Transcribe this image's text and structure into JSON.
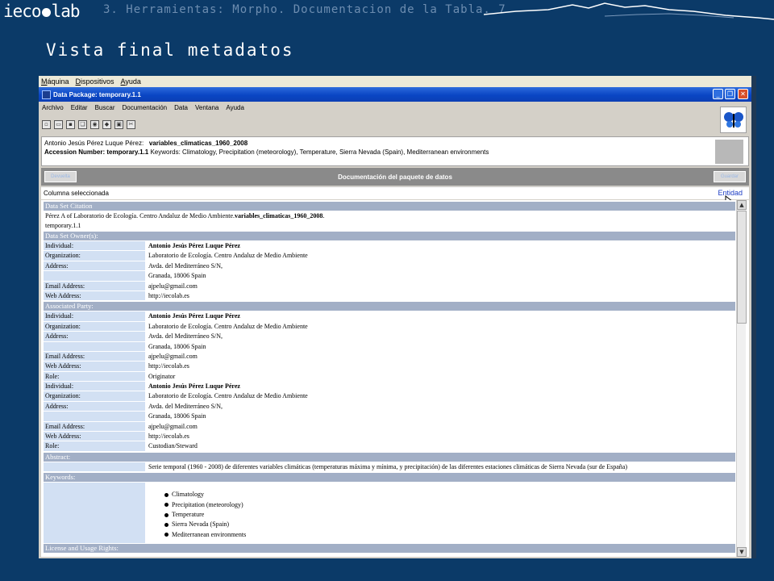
{
  "slide": {
    "logo_left": "ieco",
    "logo_right": "lab",
    "header": "3. Herramientas: Morpho. Documentacion de la Tabla. 7",
    "title": "Vista final metadatos"
  },
  "vm_menu": [
    "Máquina",
    "Dispositivos",
    "Ayuda"
  ],
  "window": {
    "title": "Data Package: temporary.1.1",
    "menu": [
      "Archivo",
      "Editar",
      "Buscar",
      "Documentación",
      "Data",
      "Ventana",
      "Ayuda"
    ]
  },
  "info": {
    "owner_label": "Antonio Jesús Pérez Luque Pérez:",
    "package_name": "variables_climaticas_1960_2008",
    "accession_label": "Accession Number: temporary.1.1",
    "keywords_line": "Keywords: Climatology, Precipitation (meteorology), Temperature, Sierra Nevada (Spain), Mediterranean environments"
  },
  "doc_bar": {
    "title": "Documentación del paquete de datos",
    "left_button": "Devuelta",
    "right_button": "Guardar"
  },
  "column": {
    "label": "Columna seleccionada",
    "link": "Entidad"
  },
  "doc": {
    "citation_header": "Data Set Citation",
    "citation_pre": "Pérez A of Laboratorio de Ecología. Centro Andaluz de Medio Ambiente.",
    "citation_name": "variables_climaticas_1960_2008",
    "citation_post": ".",
    "citation_id": "temporary.1.1",
    "owner_header": "Data Set Owner(s):",
    "owner": [
      {
        "k": "Individual:",
        "v": "Antonio Jesús Pérez Luque Pérez",
        "bold": true
      },
      {
        "k": "Organization:",
        "v": "Laboratorio de Ecología. Centro Andaluz de Medio Ambiente"
      },
      {
        "k": "Address:",
        "v": "Avda. del Mediterráneo S/N,"
      },
      {
        "k": "",
        "v": "Granada, 18006 Spain"
      },
      {
        "k": "Email Address:",
        "v": "ajpelu@gmail.com"
      },
      {
        "k": "Web Address:",
        "v": "http://iecolab.es"
      }
    ],
    "party_header": "Associated Party:",
    "party": [
      {
        "k": "Individual:",
        "v": "Antonio Jesús Pérez Luque Pérez",
        "bold": true
      },
      {
        "k": "Organization:",
        "v": "Laboratorio de Ecología. Centro Andaluz de Medio Ambiente"
      },
      {
        "k": "Address:",
        "v": "Avda. del Mediterráneo S/N,"
      },
      {
        "k": "",
        "v": "Granada, 18006 Spain"
      },
      {
        "k": "Email Address:",
        "v": "ajpelu@gmail.com"
      },
      {
        "k": "Web Address:",
        "v": "http://iecolab.es"
      },
      {
        "k": "Role:",
        "v": "Originator"
      },
      {
        "k": "Individual:",
        "v": "Antonio Jesús Pérez Luque Pérez",
        "bold": true
      },
      {
        "k": "Organization:",
        "v": "Laboratorio de Ecología. Centro Andaluz de Medio Ambiente"
      },
      {
        "k": "Address:",
        "v": "Avda. del Mediterráneo S/N,"
      },
      {
        "k": "",
        "v": "Granada, 18006 Spain"
      },
      {
        "k": "Email Address:",
        "v": "ajpelu@gmail.com"
      },
      {
        "k": "Web Address:",
        "v": "http://iecolab.es"
      },
      {
        "k": "Role:",
        "v": "Custodian/Steward"
      }
    ],
    "abstract_header": "Abstract:",
    "abstract": "Serie temporal (1960 - 2008) de diferentes variables climáticas (temperaturas máxima y mínima, y precipitación) de las diferentes estaciones climáticas de Sierra Nevada (sur de España)",
    "keywords_header": "Keywords:",
    "keywords": [
      "Climatology",
      "Precipitation (meteorology)",
      "Temperature",
      "Sierra Nevada (Spain)",
      "Mediterranean environments"
    ],
    "license_header": "License and Usage Rights:"
  },
  "colors": {
    "slide_bg": "#0b3a68",
    "section_header": "#a2afc6",
    "label_cell": "#d2e0f3",
    "titlebar": "#0a46c4"
  }
}
